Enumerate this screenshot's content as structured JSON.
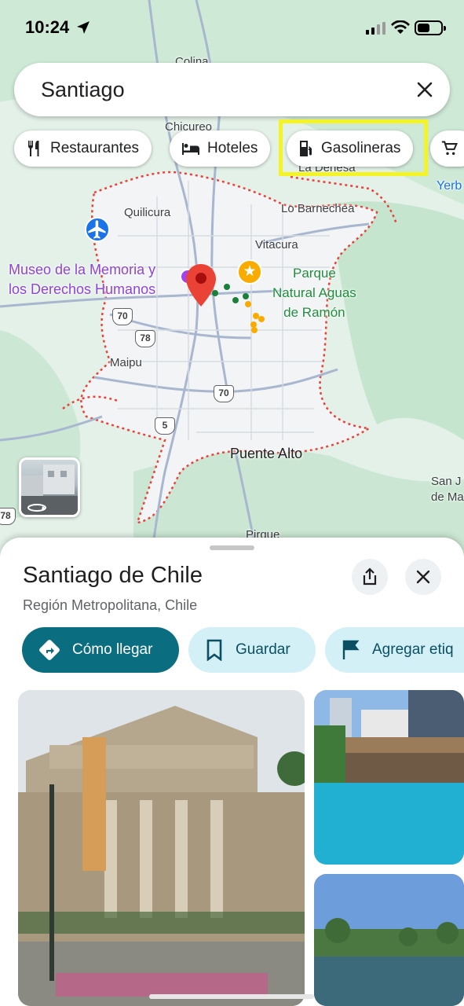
{
  "status_bar": {
    "time": "10:24",
    "battery_level": 0.55
  },
  "search": {
    "query": "Santiago"
  },
  "chips": [
    {
      "label": "Restaurantes",
      "icon": "fork-knife-icon"
    },
    {
      "label": "Hoteles",
      "icon": "bed-icon"
    },
    {
      "label": "Gasolineras",
      "icon": "gas-station-icon",
      "highlighted": true
    },
    {
      "label": "",
      "icon": "shopping-cart-icon"
    }
  ],
  "map": {
    "labels": {
      "colina": "Colina",
      "chicureo": "Chicureo",
      "quilicura": "Quilicura",
      "lo_barnechea": "Lo Barnechea",
      "la_dehesa": "La Dehesa",
      "vitacura": "Vitacura",
      "museo_line1": "Museo de la Memoria y",
      "museo_line2": "los Derechos Humanos",
      "parque_line1": "Parque",
      "parque_line2": "Natural Aguas",
      "parque_line3": "de Ramón",
      "maipu": "Maipu",
      "puente_alto": "Puente Alto",
      "san_jose_line1": "San J",
      "san_jose_line2": "de Ma",
      "pirque": "Pirque",
      "yerba": "Yerb"
    },
    "route_shields": [
      "70",
      "78",
      "70",
      "5",
      "78"
    ],
    "colors": {
      "pin": "#ea4335",
      "boundary": "#e8433a",
      "park": "#c8ead3",
      "land": "#e8f3ec",
      "urban": "#f1f3f4"
    }
  },
  "sheet": {
    "title": "Santiago de Chile",
    "subtitle": "Región Metropolitana, Chile",
    "actions": {
      "directions": "Cómo llegar",
      "save": "Guardar",
      "label": "Agregar etiq"
    }
  }
}
